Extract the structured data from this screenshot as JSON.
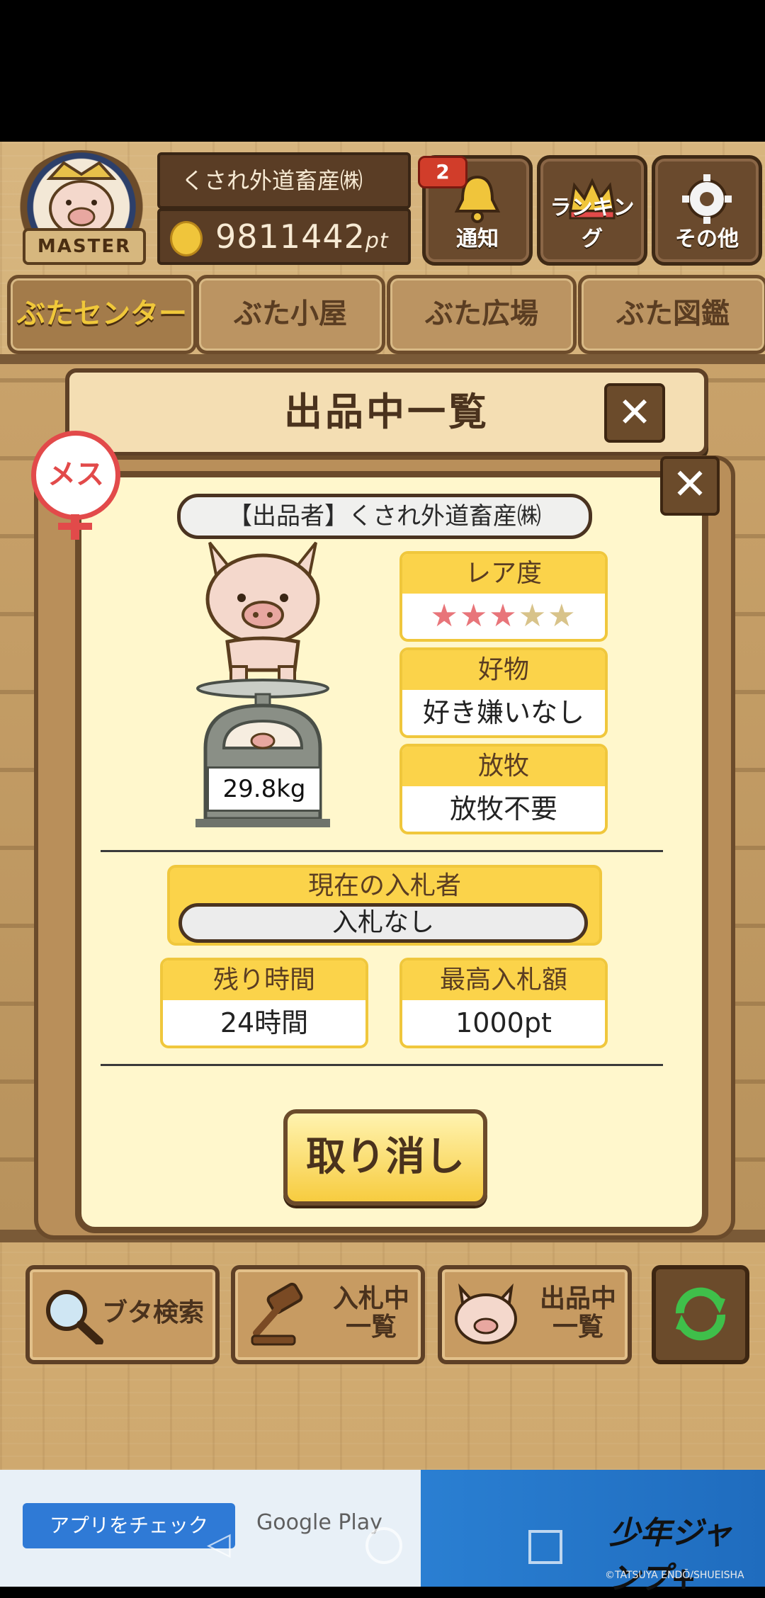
{
  "header": {
    "badge_label": "MASTER",
    "company_name": "くされ外道畜産㈱",
    "points_value": "9811442",
    "points_unit": "pt",
    "notification_count": "2",
    "buttons": [
      {
        "label": "通知",
        "icon": "bell-icon"
      },
      {
        "label": "ランキング",
        "icon": "crown-icon"
      },
      {
        "label": "その他",
        "icon": "gear-icon"
      }
    ]
  },
  "tabs": [
    {
      "label": "ぶたセンター",
      "active": true
    },
    {
      "label": "ぶた小屋",
      "active": false
    },
    {
      "label": "ぶた広場",
      "active": false
    },
    {
      "label": "ぶた図鑑",
      "active": false
    }
  ],
  "modal": {
    "title": "出品中一覧",
    "sex_badge": "メス",
    "seller": "【出品者】くされ外道畜産㈱",
    "weight": "29.8kg",
    "rarity": {
      "label": "レア度",
      "filled": 3,
      "total": 5
    },
    "favorite": {
      "label": "好物",
      "value": "好き嫌いなし"
    },
    "grazing": {
      "label": "放牧",
      "value": "放牧不要"
    },
    "bidder": {
      "label": "現在の入札者",
      "value": "入札なし"
    },
    "remaining": {
      "label": "残り時間",
      "value": "24時間"
    },
    "top_bid": {
      "label": "最高入札額",
      "value": "1000pt"
    },
    "cancel_label": "取り消し"
  },
  "bottom_nav": [
    {
      "line1": "ブタ検索",
      "line2": ""
    },
    {
      "line1": "入札中",
      "line2": "一覧"
    },
    {
      "line1": "出品中",
      "line2": "一覧"
    }
  ],
  "ad": {
    "cta": "アプリをチェック",
    "store": "Google Play",
    "logo_text": "少年ジャンプ+",
    "credit": "©TATSUYA ENDŌ/SHUEISHA"
  },
  "colors": {
    "accent_yellow": "#fbd34a",
    "wood_dark": "#6b4b2b",
    "female_red": "#e24a4a",
    "star_on": "#e8757a"
  }
}
